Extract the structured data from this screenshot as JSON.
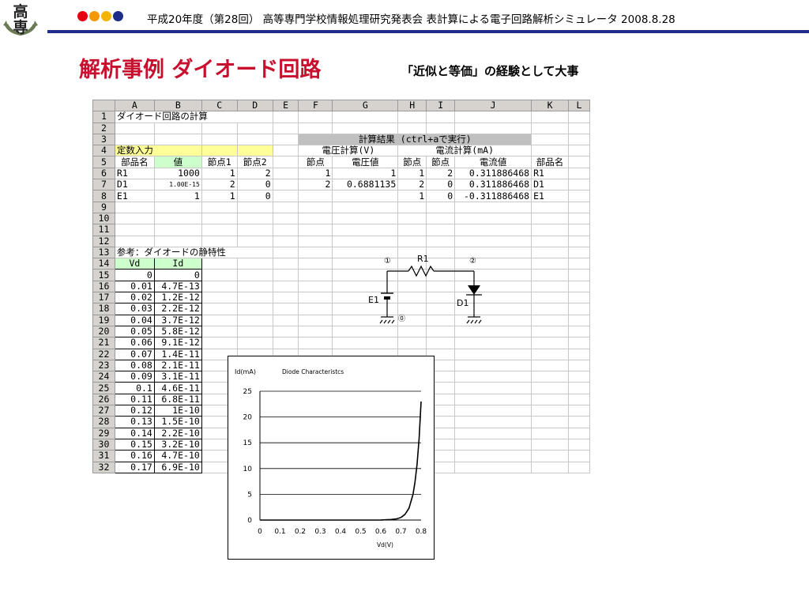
{
  "header": {
    "logo_text": "高専",
    "dot_colors": [
      "#e60012",
      "#f39800",
      "#f5b400",
      "#1f2d8a"
    ],
    "title_text": "平成20年度（第28回） 高等専門学校情報処理研究発表会  表計算による電子回路解析シミュレータ 2008.8.28"
  },
  "slide": {
    "title": "解析事例   ダイオード回路",
    "subtitle": "「近似と等価」の経験として大事"
  },
  "sheet": {
    "columns": [
      "A",
      "B",
      "C",
      "D",
      "E",
      "F",
      "G",
      "H",
      "I",
      "J",
      "K",
      "L"
    ],
    "rows": [
      [
        "ダイオード回路の計算",
        "",
        "",
        "",
        "",
        "",
        "",
        "",
        "",
        "",
        "",
        ""
      ],
      [
        "",
        "",
        "",
        "",
        "",
        "",
        "",
        "",
        "",
        "",
        "",
        ""
      ],
      [
        "",
        "",
        "",
        "",
        "",
        "計算結果 (ctrl+aで実行)",
        "",
        "",
        "",
        "",
        "",
        ""
      ],
      [
        "定数入力",
        "",
        "",
        "",
        "",
        "電圧計算(V)",
        "",
        "電流計算(mA)",
        "",
        "",
        "",
        ""
      ],
      [
        "部品名",
        "値",
        "節点1",
        "節点2",
        "",
        "節点",
        "電圧値",
        "節点",
        "節点",
        "電流値",
        "部品名",
        ""
      ],
      [
        "R1",
        "1000",
        "1",
        "2",
        "",
        "1",
        "1",
        "1",
        "2",
        "0.311886468",
        "R1",
        ""
      ],
      [
        "D1",
        "1.00E-15",
        "2",
        "0",
        "",
        "2",
        "0.6881135",
        "2",
        "0",
        "0.311886468",
        "D1",
        ""
      ],
      [
        "E1",
        "1",
        "1",
        "0",
        "",
        "",
        "",
        "1",
        "0",
        "-0.311886468",
        "E1",
        ""
      ],
      [
        "",
        "",
        "",
        "",
        "",
        "",
        "",
        "",
        "",
        "",
        "",
        ""
      ],
      [
        "",
        "",
        "",
        "",
        "",
        "",
        "",
        "",
        "",
        "",
        "",
        ""
      ],
      [
        "",
        "",
        "",
        "",
        "",
        "",
        "",
        "",
        "",
        "",
        "",
        ""
      ],
      [
        "",
        "",
        "",
        "",
        "",
        "",
        "",
        "",
        "",
        "",
        "",
        ""
      ],
      [
        "参考：ダイオードの静特性",
        "",
        "",
        "",
        "",
        "",
        "",
        "",
        "",
        "",
        "",
        ""
      ],
      [
        "Vd",
        "Id",
        "",
        "",
        "",
        "",
        "",
        "",
        "",
        "",
        "",
        ""
      ],
      [
        "0",
        "0",
        "",
        "",
        "",
        "",
        "",
        "",
        "",
        "",
        "",
        ""
      ],
      [
        "0.01",
        "4.7E-13",
        "",
        "",
        "",
        "",
        "",
        "",
        "",
        "",
        "",
        ""
      ],
      [
        "0.02",
        "1.2E-12",
        "",
        "",
        "",
        "",
        "",
        "",
        "",
        "",
        "",
        ""
      ],
      [
        "0.03",
        "2.2E-12",
        "",
        "",
        "",
        "",
        "",
        "",
        "",
        "",
        "",
        ""
      ],
      [
        "0.04",
        "3.7E-12",
        "",
        "",
        "",
        "",
        "",
        "",
        "",
        "",
        "",
        ""
      ],
      [
        "0.05",
        "5.8E-12",
        "",
        "",
        "",
        "",
        "",
        "",
        "",
        "",
        "",
        ""
      ],
      [
        "0.06",
        "9.1E-12",
        "",
        "",
        "",
        "",
        "",
        "",
        "",
        "",
        "",
        ""
      ],
      [
        "0.07",
        "1.4E-11",
        "",
        "",
        "",
        "",
        "",
        "",
        "",
        "",
        "",
        ""
      ],
      [
        "0.08",
        "2.1E-11",
        "",
        "",
        "",
        "",
        "",
        "",
        "",
        "",
        "",
        ""
      ],
      [
        "0.09",
        "3.1E-11",
        "",
        "",
        "",
        "",
        "",
        "",
        "",
        "",
        "",
        ""
      ],
      [
        "0.1",
        "4.6E-11",
        "",
        "",
        "",
        "",
        "",
        "",
        "",
        "",
        "",
        ""
      ],
      [
        "0.11",
        "6.8E-11",
        "",
        "",
        "",
        "",
        "",
        "",
        "",
        "",
        "",
        ""
      ],
      [
        "0.12",
        "1E-10",
        "",
        "",
        "",
        "",
        "",
        "",
        "",
        "",
        "",
        ""
      ],
      [
        "0.13",
        "1.5E-10",
        "",
        "",
        "",
        "",
        "",
        "",
        "",
        "",
        "",
        ""
      ],
      [
        "0.14",
        "2.2E-10",
        "",
        "",
        "",
        "",
        "",
        "",
        "",
        "",
        "",
        ""
      ],
      [
        "0.15",
        "3.2E-10",
        "",
        "",
        "",
        "",
        "",
        "",
        "",
        "",
        "",
        ""
      ],
      [
        "0.16",
        "4.7E-10",
        "",
        "",
        "",
        "",
        "",
        "",
        "",
        "",
        "",
        ""
      ],
      [
        "0.17",
        "6.9E-10",
        "",
        "",
        "",
        "",
        "",
        "",
        "",
        "",
        "",
        ""
      ]
    ]
  },
  "circuit": {
    "node1": "①",
    "node2": "②",
    "node0": "⓪",
    "resistor": "R1",
    "source": "E1",
    "diode": "D1"
  },
  "chart_data": {
    "type": "line",
    "title": "Diode Characteristcs",
    "ylabel": "Id(mA)",
    "xlabel": "Vd(V)",
    "xlim": [
      0,
      0.8
    ],
    "ylim": [
      0,
      25
    ],
    "x_ticks": [
      "0",
      "0.1",
      "0.2",
      "0.3",
      "0.4",
      "0.5",
      "0.6",
      "0.7",
      "0.8"
    ],
    "y_ticks": [
      "0",
      "5",
      "10",
      "15",
      "20",
      "25"
    ],
    "grid": true,
    "x": [
      0,
      0.1,
      0.2,
      0.3,
      0.4,
      0.5,
      0.6,
      0.65,
      0.68,
      0.7,
      0.72,
      0.74,
      0.76,
      0.77,
      0.78,
      0.79,
      0.8
    ],
    "y": [
      0,
      0,
      0,
      0,
      0,
      0,
      0.02,
      0.1,
      0.25,
      0.5,
      1.1,
      2.3,
      5.0,
      7.4,
      10.8,
      15.8,
      23.0
    ]
  }
}
